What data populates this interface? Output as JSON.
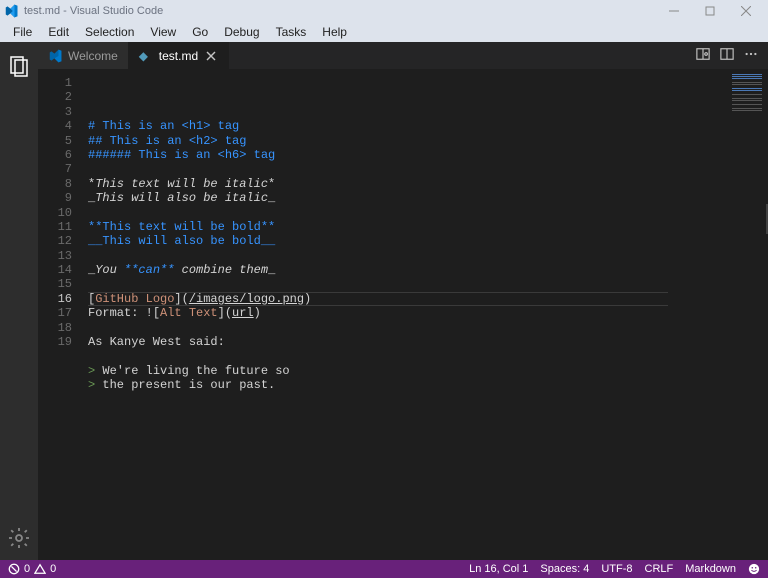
{
  "window": {
    "title": "test.md - Visual Studio Code"
  },
  "menu": {
    "file": "File",
    "edit": "Edit",
    "selection": "Selection",
    "view": "View",
    "go": "Go",
    "debug": "Debug",
    "tasks": "Tasks",
    "help": "Help"
  },
  "tabs": {
    "welcome": "Welcome",
    "file": "test.md"
  },
  "editor": {
    "cursor_line": 16,
    "lines": [
      {
        "n": 1,
        "segments": [
          {
            "t": "# This is an <h1> tag",
            "c": "tok-heading"
          }
        ]
      },
      {
        "n": 2,
        "segments": [
          {
            "t": "## This is an <h2> tag",
            "c": "tok-heading"
          }
        ]
      },
      {
        "n": 3,
        "segments": [
          {
            "t": "###### This is an <h6> tag",
            "c": "tok-heading"
          }
        ]
      },
      {
        "n": 4,
        "segments": []
      },
      {
        "n": 5,
        "segments": [
          {
            "t": "*",
            "c": "tok-default"
          },
          {
            "t": "This text will be italic",
            "c": "tok-italic tok-default"
          },
          {
            "t": "*",
            "c": "tok-default"
          }
        ]
      },
      {
        "n": 6,
        "segments": [
          {
            "t": "_",
            "c": "tok-default"
          },
          {
            "t": "This will also be italic",
            "c": "tok-italic tok-default"
          },
          {
            "t": "_",
            "c": "tok-default"
          }
        ]
      },
      {
        "n": 7,
        "segments": []
      },
      {
        "n": 8,
        "segments": [
          {
            "t": "**This text will be bold**",
            "c": "tok-heading"
          }
        ]
      },
      {
        "n": 9,
        "segments": [
          {
            "t": "__This will also be bold__",
            "c": "tok-heading"
          }
        ]
      },
      {
        "n": 10,
        "segments": []
      },
      {
        "n": 11,
        "segments": [
          {
            "t": "_",
            "c": "tok-default"
          },
          {
            "t": "You ",
            "c": "tok-italic tok-default"
          },
          {
            "t": "**can**",
            "c": "tok-heading tok-italic"
          },
          {
            "t": " combine them",
            "c": "tok-italic tok-default"
          },
          {
            "t": "_",
            "c": "tok-default"
          }
        ]
      },
      {
        "n": 12,
        "segments": []
      },
      {
        "n": 13,
        "segments": [
          {
            "t": "[",
            "c": "tok-delim"
          },
          {
            "t": "GitHub Logo",
            "c": "tok-linktext"
          },
          {
            "t": "](",
            "c": "tok-delim"
          },
          {
            "t": "/images/logo.png",
            "c": "tok-underline"
          },
          {
            "t": ")",
            "c": "tok-delim"
          }
        ]
      },
      {
        "n": 14,
        "segments": [
          {
            "t": "Format: !",
            "c": "tok-default"
          },
          {
            "t": "[",
            "c": "tok-delim"
          },
          {
            "t": "Alt Text",
            "c": "tok-linktext"
          },
          {
            "t": "](",
            "c": "tok-delim"
          },
          {
            "t": "url",
            "c": "tok-underline"
          },
          {
            "t": ")",
            "c": "tok-delim"
          }
        ]
      },
      {
        "n": 15,
        "segments": []
      },
      {
        "n": 16,
        "segments": [
          {
            "t": "As Kanye West said:",
            "c": "tok-default"
          }
        ]
      },
      {
        "n": 17,
        "segments": []
      },
      {
        "n": 18,
        "segments": [
          {
            "t": ">",
            "c": "tok-quote"
          },
          {
            "t": " We're living the future so",
            "c": "tok-default"
          }
        ]
      },
      {
        "n": 19,
        "segments": [
          {
            "t": ">",
            "c": "tok-quote"
          },
          {
            "t": " the present is our past.",
            "c": "tok-default"
          }
        ]
      }
    ]
  },
  "status": {
    "errors": "0",
    "warnings": "0",
    "cursor": "Ln 16, Col 1",
    "spaces": "Spaces: 4",
    "encoding": "UTF-8",
    "eol": "CRLF",
    "language": "Markdown"
  }
}
